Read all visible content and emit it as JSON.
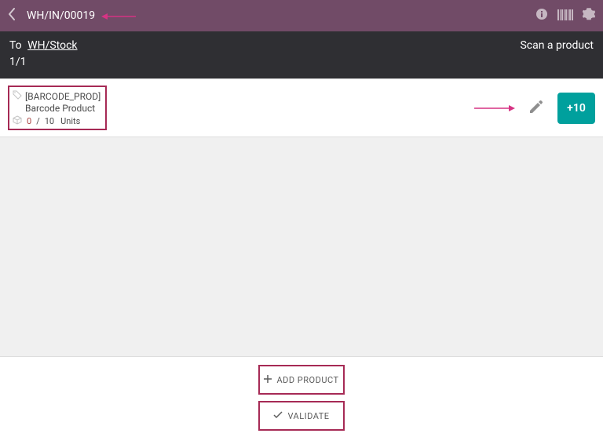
{
  "topbar": {
    "title": "WH/IN/00019"
  },
  "subhead": {
    "to_label": "To",
    "destination": "WH/Stock",
    "counter": "1/1",
    "scan_prompt": "Scan a product"
  },
  "product": {
    "sku": "[BARCODE_PROD]",
    "name": "Barcode Product",
    "qty_done": "0",
    "qty_sep": "/",
    "qty_expected": "10",
    "uom": "Units",
    "plus_label": "+10"
  },
  "footer": {
    "add_label": "ADD PRODUCT",
    "validate_label": "VALIDATE"
  },
  "colors": {
    "brand": "#714b67",
    "accent": "#00a09d",
    "highlight_border": "#a62a55"
  }
}
